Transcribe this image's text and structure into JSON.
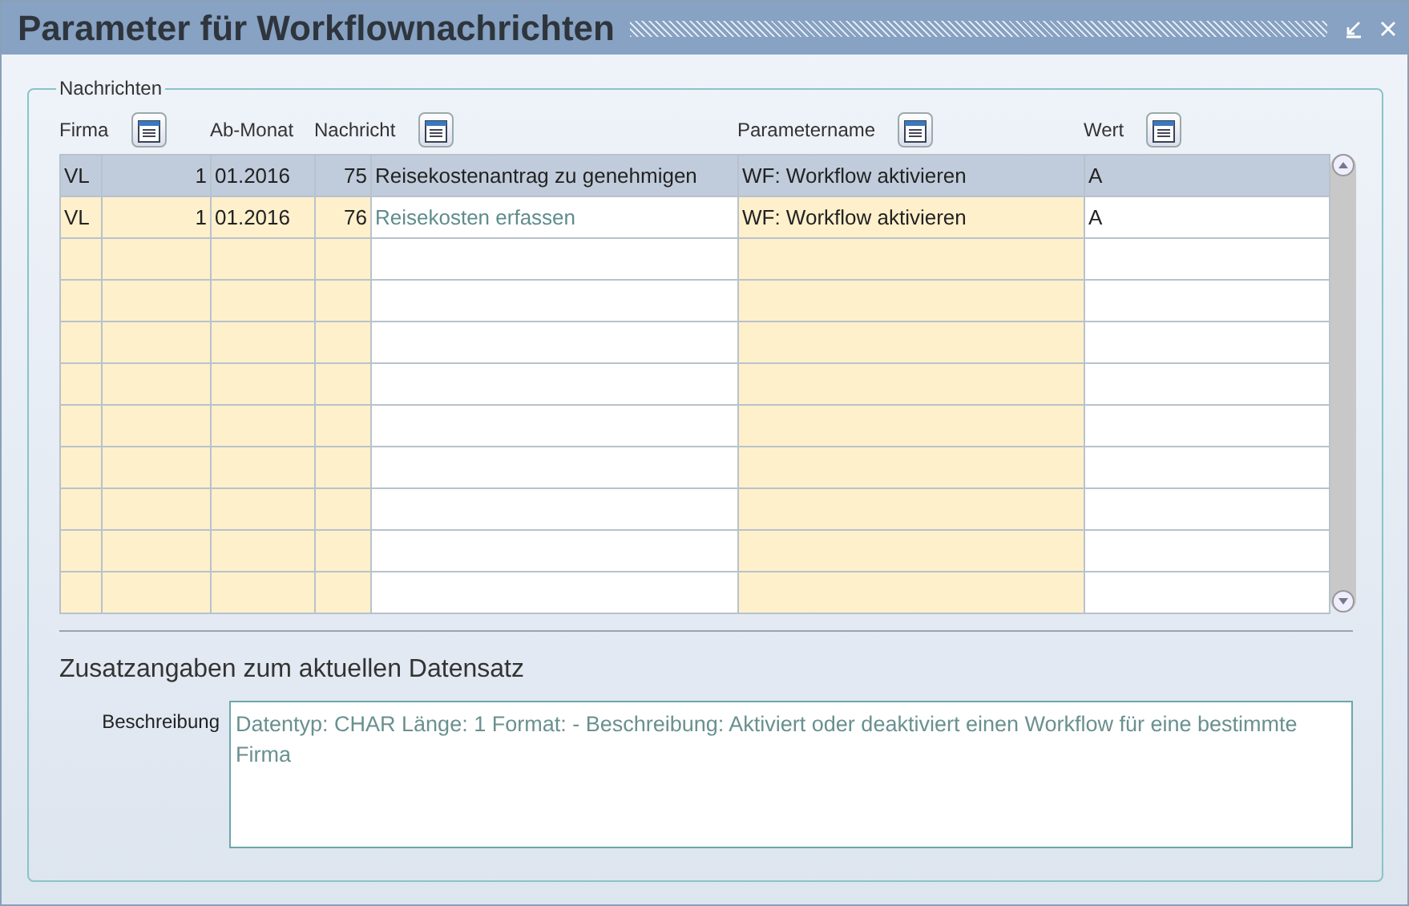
{
  "window": {
    "title": "Parameter für Workflownachrichten"
  },
  "group": {
    "legend": "Nachrichten"
  },
  "table": {
    "headers": [
      {
        "label": "Firma",
        "sort_button": true
      },
      {
        "label": "Ab-Monat",
        "sort_button": false
      },
      {
        "label": "Nachricht",
        "sort_button": true
      },
      {
        "label": "Parametername",
        "sort_button": true
      },
      {
        "label": "Wert",
        "sort_button": true
      }
    ],
    "columns": [
      {
        "kind": "input"
      },
      {
        "kind": "input-number"
      },
      {
        "kind": "input"
      },
      {
        "kind": "input-number"
      },
      {
        "kind": "display"
      },
      {
        "kind": "input"
      },
      {
        "kind": "plain"
      }
    ],
    "rows": [
      {
        "selected": true,
        "cells": [
          "VL",
          "1",
          "01.2016",
          "75",
          "Reisekostenantrag zu genehmigen",
          "WF: Workflow aktivieren",
          "A"
        ]
      },
      {
        "selected": false,
        "cells": [
          "VL",
          "1",
          "01.2016",
          "76",
          "Reisekosten erfassen",
          "WF: Workflow aktivieren",
          "A"
        ]
      }
    ]
  },
  "details": {
    "heading": "Zusatzangaben zum aktuellen Datensatz",
    "label": "Beschreibung",
    "value": "Datentyp: CHAR Länge: 1 Format: - Beschreibung: Aktiviert oder deaktiviert einen Workflow für eine bestimmte Firma"
  }
}
